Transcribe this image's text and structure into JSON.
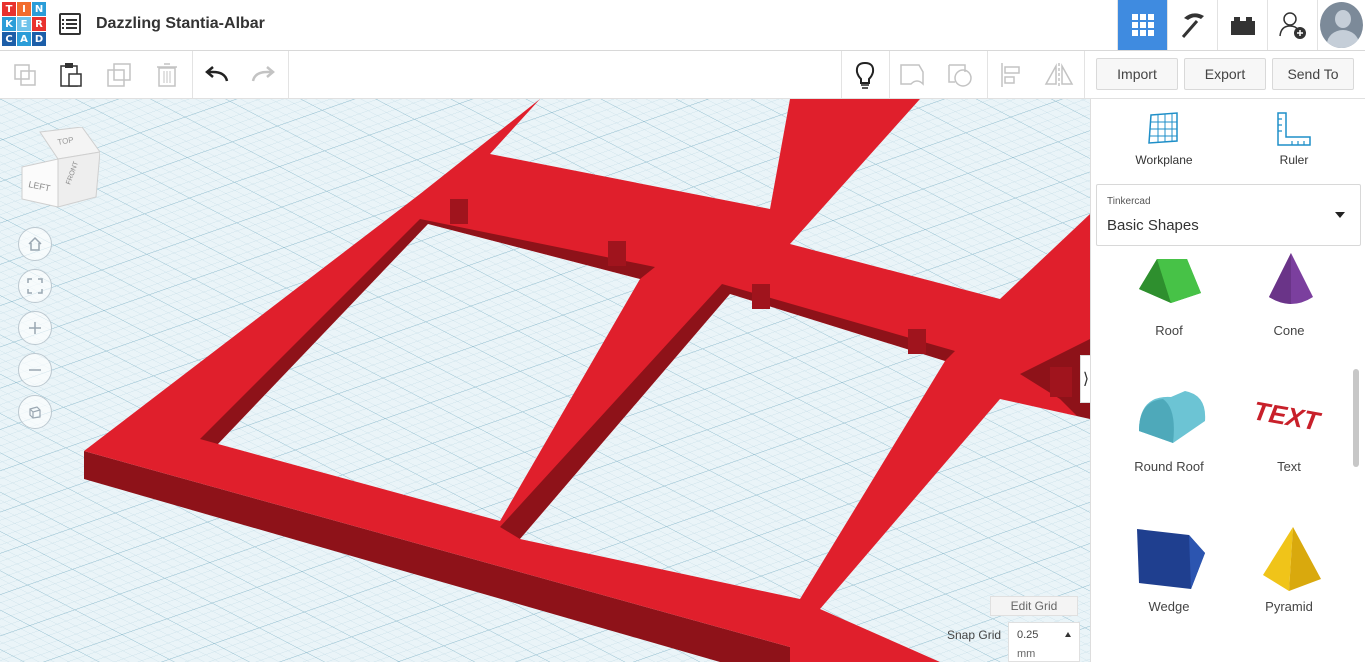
{
  "app": {
    "logo_letters": [
      "T",
      "I",
      "N",
      "K",
      "E",
      "R",
      "C",
      "A",
      "D"
    ],
    "project_title": "Dazzling Stantia-Albar"
  },
  "header": {
    "buttons": [
      {
        "name": "3d-design-view",
        "icon": "grid-icon",
        "active": true
      },
      {
        "name": "codeblocks",
        "icon": "pickaxe-icon",
        "active": false
      },
      {
        "name": "bricks",
        "icon": "lego-brick-icon",
        "active": false
      },
      {
        "name": "invite",
        "icon": "add-user-icon",
        "active": false
      },
      {
        "name": "profile",
        "icon": "avatar-icon",
        "active": false
      }
    ]
  },
  "toolbar": {
    "tools": [
      "copy-icon",
      "paste-icon",
      "duplicate-icon",
      "delete-icon",
      "undo-icon",
      "redo-icon",
      "light-bulb-icon",
      "group-icon",
      "ungroup-icon",
      "align-icon",
      "mirror-icon"
    ]
  },
  "actions": {
    "import_label": "Import",
    "export_label": "Export",
    "sendto_label": "Send To"
  },
  "panel": {
    "workplane_label": "Workplane",
    "ruler_label": "Ruler",
    "library_small": "Tinkercad",
    "library_main": "Basic Shapes",
    "shapes": [
      {
        "label": "Roof",
        "color": "#3fae3f"
      },
      {
        "label": "Cone",
        "color": "#7b3f9e"
      },
      {
        "label": "Round Roof",
        "color": "#5bb8c8"
      },
      {
        "label": "Text",
        "color": "#c8202a"
      },
      {
        "label": "Wedge",
        "color": "#1f3f8f"
      },
      {
        "label": "Pyramid",
        "color": "#f0c419"
      }
    ]
  },
  "viewcube": {
    "top": "TOP",
    "left": "LEFT",
    "front": "FRONT"
  },
  "canvas": {
    "accent": "#e01f2c",
    "edit_grid_label": "Edit Grid",
    "snap_grid_label": "Snap Grid",
    "snap_value": "0.25",
    "snap_unit": "mm"
  }
}
